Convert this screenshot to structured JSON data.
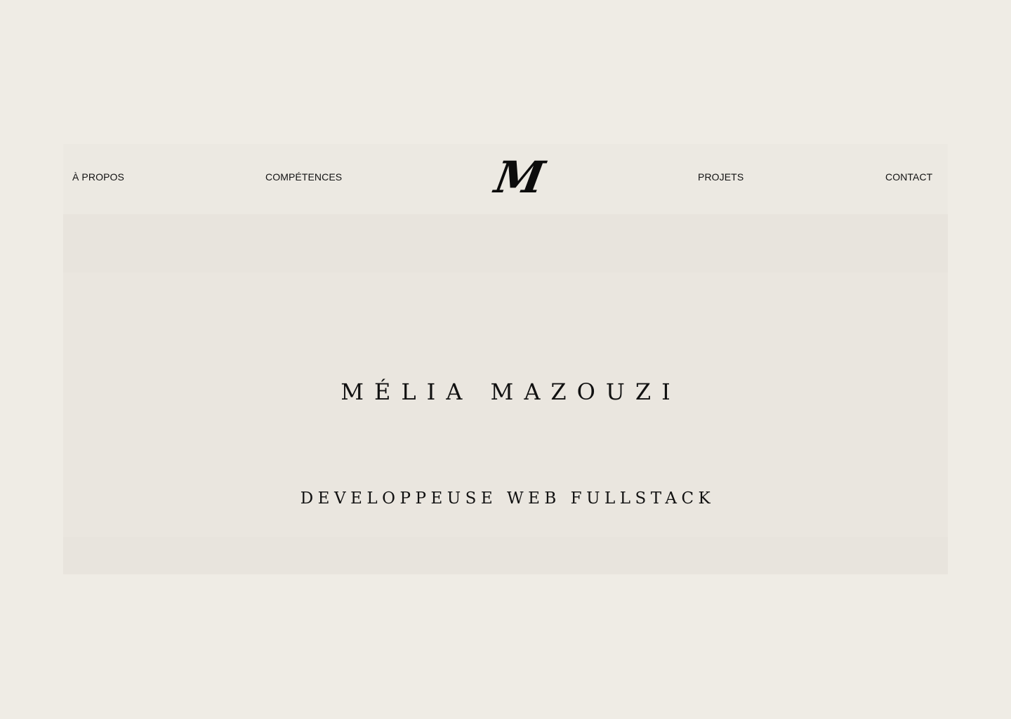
{
  "nav": {
    "items": [
      {
        "label": "À PROPOS"
      },
      {
        "label": "COMPÉTENCES"
      },
      {
        "label": "PROJETS"
      },
      {
        "label": "CONTACT"
      }
    ],
    "logo": "M"
  },
  "hero": {
    "name": "MÉLIA MAZOUZI",
    "role": "DEVELOPPEUSE WEB FULLSTACK"
  },
  "colors": {
    "background": "#efece5",
    "panel": "#eae6df",
    "text": "#111111"
  }
}
